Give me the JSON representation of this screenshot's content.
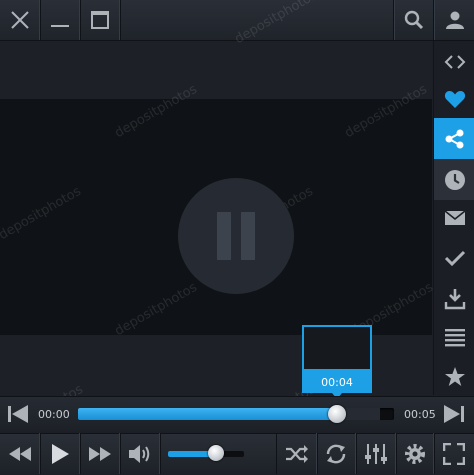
{
  "player": {
    "accent_color": "#1ea0e6",
    "state": "playing"
  },
  "titlebar": {
    "icons": [
      "close-icon",
      "minimize-icon",
      "maximize-icon",
      "search-icon",
      "user-icon"
    ]
  },
  "sidebar": {
    "items": [
      {
        "icon": "embed-code-icon"
      },
      {
        "icon": "heart-icon"
      },
      {
        "icon": "share-icon",
        "active": true
      },
      {
        "icon": "clock-icon"
      },
      {
        "icon": "mail-icon"
      },
      {
        "icon": "check-icon"
      },
      {
        "icon": "download-icon"
      },
      {
        "icon": "playlist-icon"
      },
      {
        "icon": "star-icon"
      }
    ]
  },
  "seek": {
    "current_time": "00:00",
    "total_time": "00:05",
    "preview_time": "00:04",
    "progress_fraction": 0.82
  },
  "controls": {
    "icons": [
      "rewind-icon",
      "play-icon",
      "fast-forward-icon",
      "volume-icon",
      "shuffle-icon",
      "repeat-icon",
      "equalizer-icon",
      "settings-icon",
      "fullscreen-icon"
    ],
    "volume_fraction": 0.63
  },
  "watermark": {
    "text": "depositphotos"
  }
}
